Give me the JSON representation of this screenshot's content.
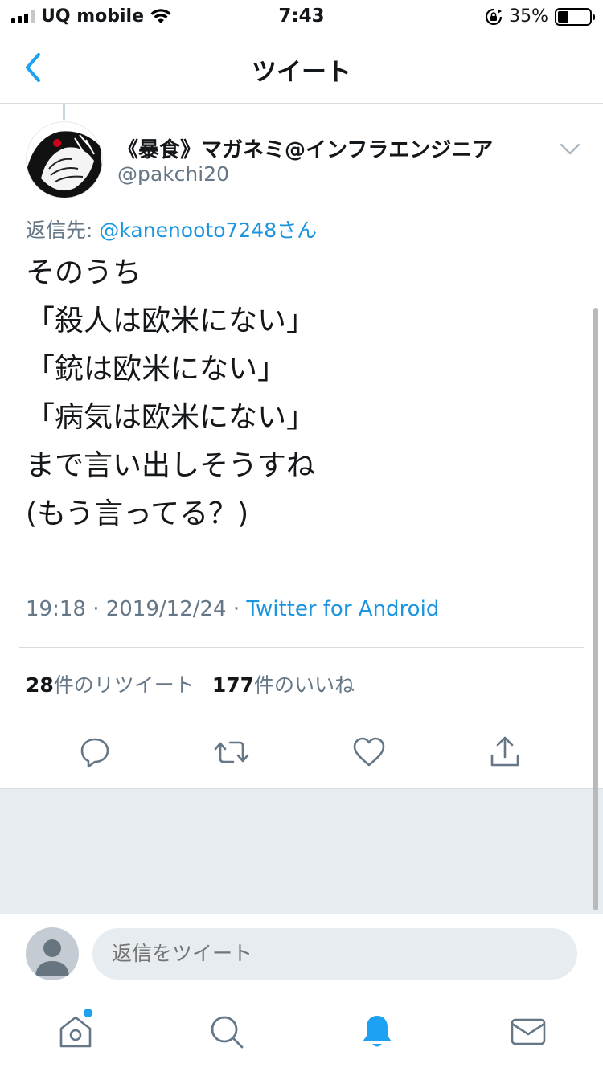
{
  "status_bar": {
    "carrier": "UQ mobile",
    "time": "7:43",
    "battery": "35%",
    "battery_level": 0.35
  },
  "nav": {
    "title": "ツイート"
  },
  "tweet": {
    "display_name": "《暴食》マガネミ@インフラエンジニア",
    "handle": "@pakchi20",
    "reply_prefix": "返信先: ",
    "reply_mention": "@kanenooto7248さん",
    "lines": [
      "そのうち",
      "「殺人は欧米にない」",
      "「銃は欧米にない」",
      "「病気は欧米にない」",
      "まで言い出しそうすね",
      "(もう言ってる？)"
    ],
    "timestamp": "19:18 · 2019/12/24 · ",
    "source": "Twitter for Android",
    "retweet_count": "28",
    "retweet_label": "件のリツイート",
    "like_count": "177",
    "like_label": "件のいいね"
  },
  "reply_bar": {
    "placeholder": "返信をツイート"
  },
  "icons": {
    "back": "chevron-left-icon",
    "caret": "chevron-down-icon",
    "reply": "reply-icon",
    "retweet": "retweet-icon",
    "like": "heart-icon",
    "share": "share-icon",
    "home": "home-icon",
    "search": "search-icon",
    "notifications": "bell-icon",
    "messages": "mail-icon"
  },
  "colors": {
    "accent": "#1da1f2",
    "link": "#1b95e0",
    "secondary_text": "#657786"
  }
}
